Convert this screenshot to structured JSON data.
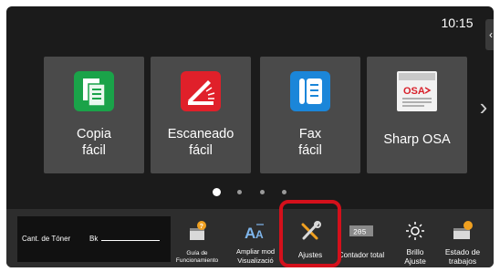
{
  "status": {
    "time": "10:15"
  },
  "tiles": [
    {
      "line1": "Copia",
      "line2": "fácil",
      "icon": "copy-icon"
    },
    {
      "line1": "Escaneado",
      "line2": "fácil",
      "icon": "scan-icon"
    },
    {
      "line1": "Fax",
      "line2": "fácil",
      "icon": "fax-icon"
    },
    {
      "line1": "Sharp OSA",
      "line2": "",
      "icon": "sharp-osa-icon"
    }
  ],
  "pager": {
    "pages": 4,
    "current": 1
  },
  "toner": {
    "label": "Cant. de Tóner",
    "color_label": "Bk"
  },
  "taskbar": {
    "guide_line1": "Guía de",
    "guide_line2": "Funcionamiento",
    "zoom_line1": "Ampliar mod",
    "zoom_line2": "Visualizació",
    "settings": "Ajustes",
    "counter": "Contador total",
    "counter_icon_text": "205",
    "brightness_line1": "Brillo",
    "brightness_line2": "Ajuste",
    "jobs_line1": "Estado de",
    "jobs_line2": "trabajos"
  },
  "colors": {
    "highlight": "#d4101b",
    "copy": "#1aa349",
    "scan": "#e0202a",
    "fax": "#1b86d9"
  }
}
